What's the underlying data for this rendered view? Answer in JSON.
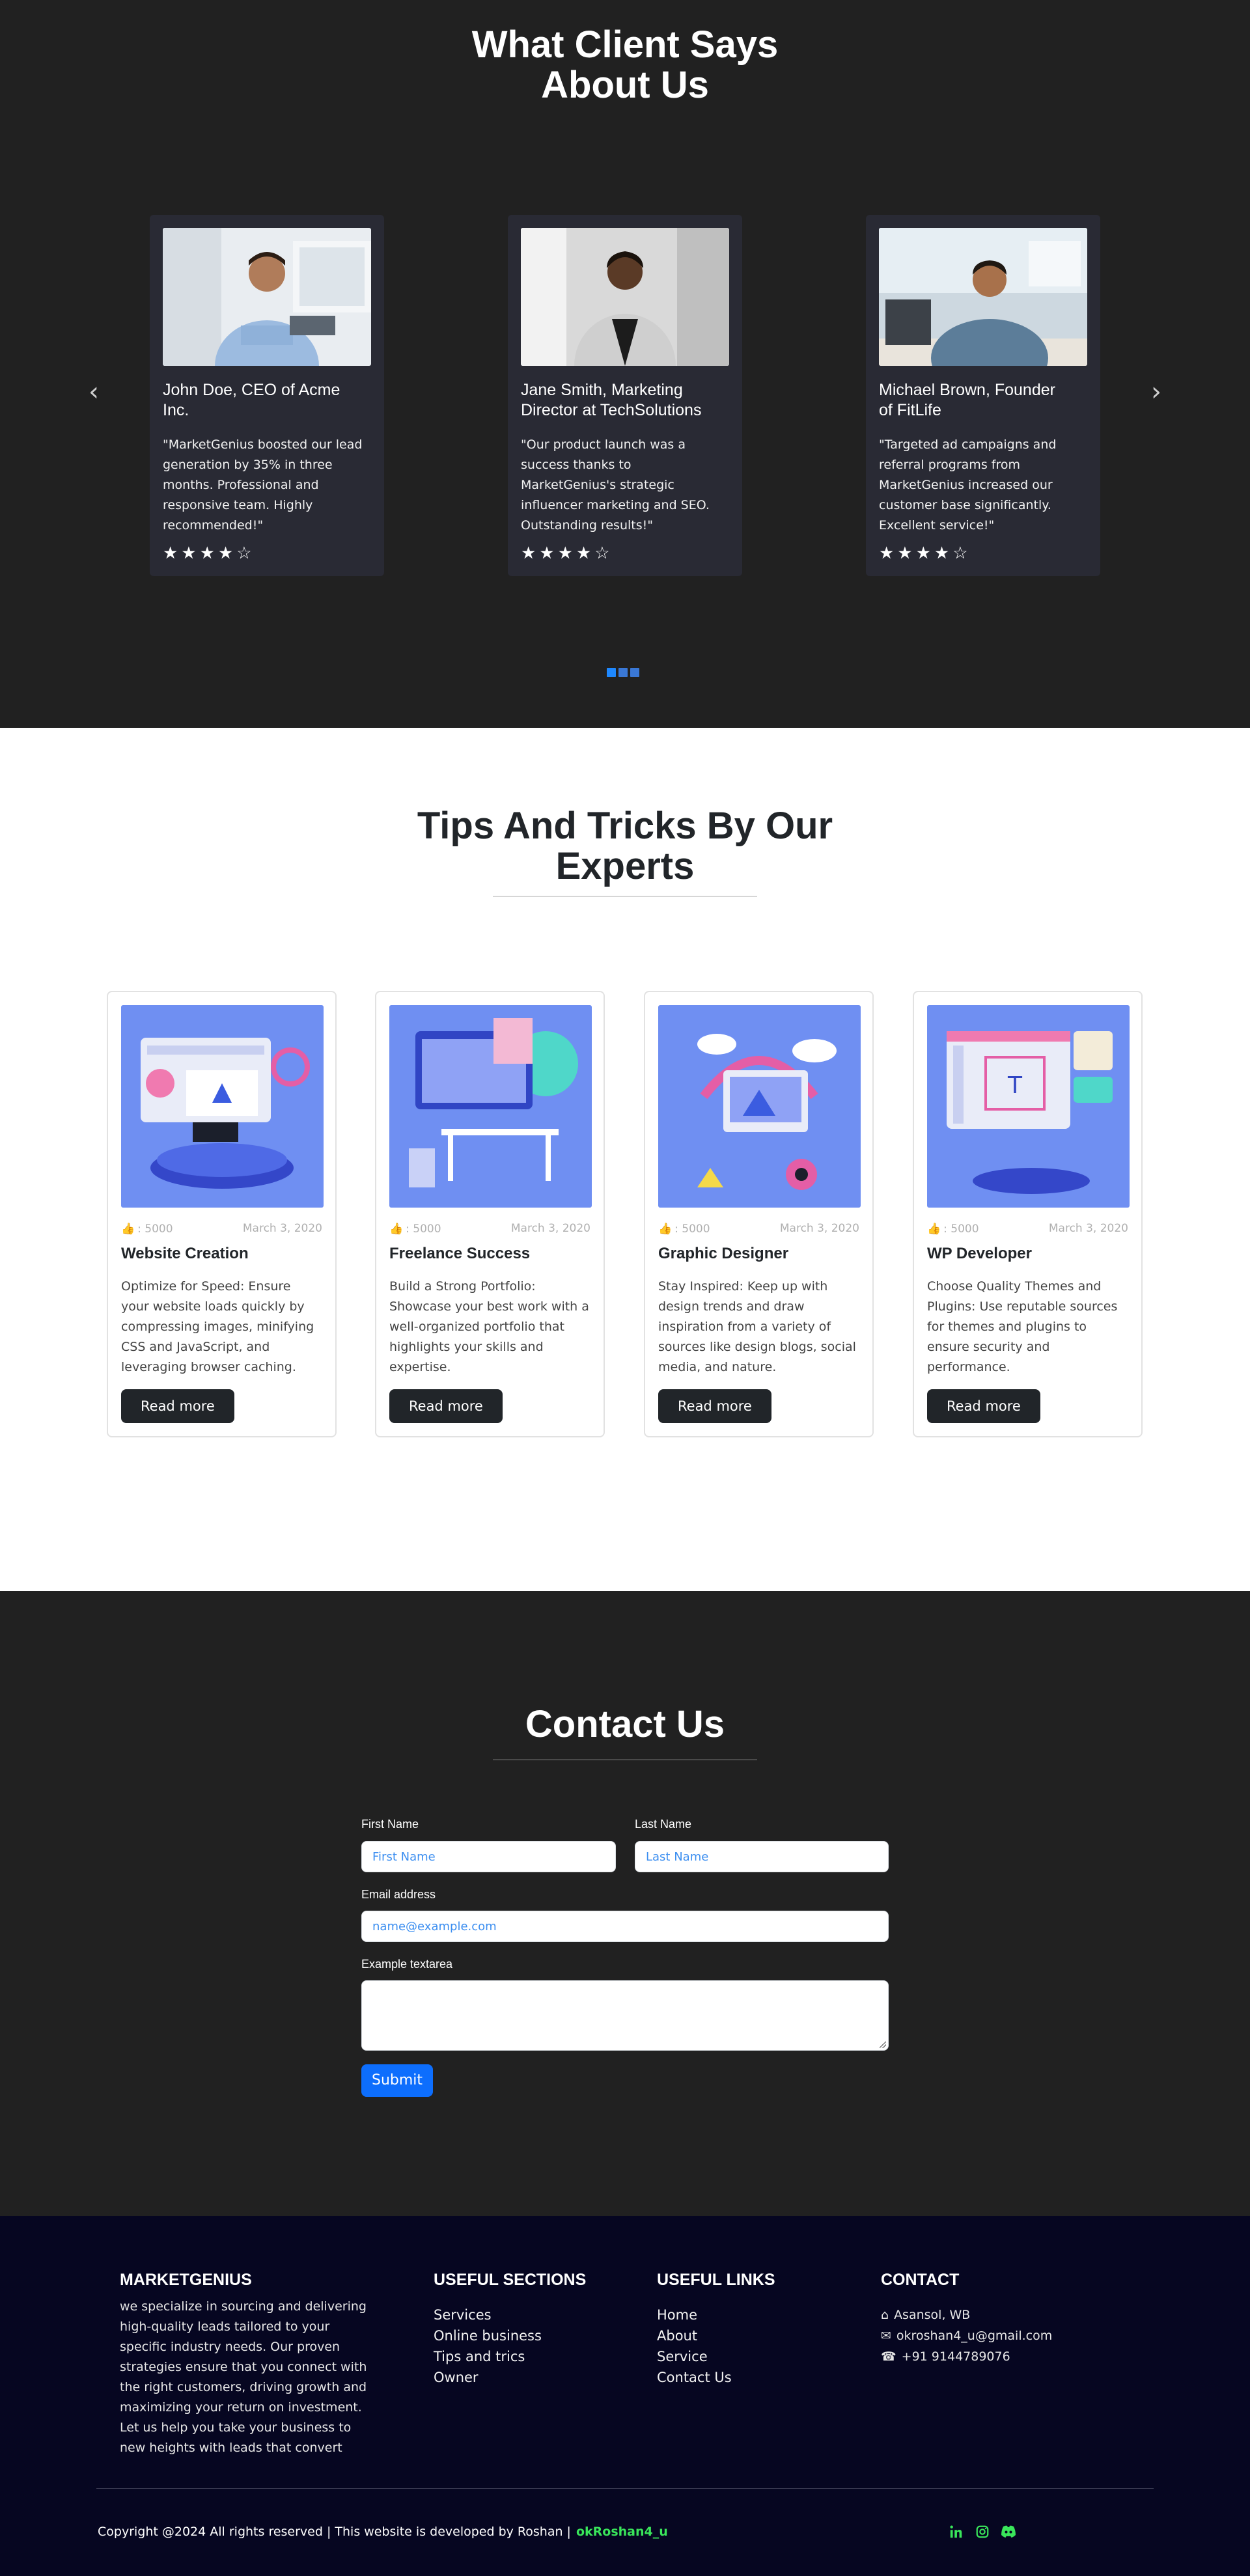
{
  "testimonials": {
    "title_line1": "What Client Says",
    "title_line2": "About Us",
    "prev_icon": "chevron-left-icon",
    "next_icon": "chevron-right-icon",
    "cards": [
      {
        "name_line1": "John Doe, CEO of Acme",
        "name_line2": "Inc.",
        "quote": "\"MarketGenius boosted our lead generation by 35% in three months. Professional and responsive team. Highly recommended!\"",
        "rating": 4,
        "stars": "★★★★☆"
      },
      {
        "name_line1": "Jane Smith, Marketing",
        "name_line2": "Director at TechSolutions",
        "quote": "\"Our product launch was a success thanks to MarketGenius's strategic influencer marketing and SEO. Outstanding results!\"",
        "rating": 4,
        "stars": "★★★★☆"
      },
      {
        "name_line1": "Michael Brown, Founder",
        "name_line2": "of FitLife",
        "quote": "\"Targeted ad campaigns and referral programs from MarketGenius increased our customer base significantly. Excellent service!\"",
        "rating": 4,
        "stars": "★★★★☆"
      }
    ],
    "indicator_count": 3,
    "active_indicator": 1
  },
  "tips": {
    "title_line1": "Tips And Tricks By Our",
    "title_line2": "Experts",
    "cards": [
      {
        "likes": ": 5000",
        "date": "March 3, 2020",
        "title": "Website Creation",
        "text": "Optimize for Speed: Ensure your website loads quickly by compressing images, minifying CSS and JavaScript, and leveraging browser caching.",
        "button": "Read more"
      },
      {
        "likes": ": 5000",
        "date": "March 3, 2020",
        "title": "Freelance Success",
        "text": "Build a Strong Portfolio: Showcase your best work with a well-organized portfolio that highlights your skills and expertise.",
        "button": "Read more"
      },
      {
        "likes": ": 5000",
        "date": "March 3, 2020",
        "title": "Graphic Designer",
        "text": "Stay Inspired: Keep up with design trends and draw inspiration from a variety of sources like design blogs, social media, and nature.",
        "button": "Read more"
      },
      {
        "likes": ": 5000",
        "date": "March 3, 2020",
        "title": "WP Developer",
        "text": "Choose Quality Themes and Plugins: Use reputable sources for themes and plugins to ensure security and performance.",
        "button": "Read more"
      }
    ]
  },
  "contact": {
    "title": "Contact Us",
    "first_name_label": "First Name",
    "first_name_placeholder": "First Name",
    "last_name_label": "Last Name",
    "last_name_placeholder": "Last Name",
    "email_label": "Email address",
    "email_placeholder": "name@example.com",
    "textarea_label": "Example textarea",
    "submit": "Submit"
  },
  "footer": {
    "brand": "MARKETGENIUS",
    "about": "we specialize in sourcing and delivering high-quality leads tailored to your specific industry needs. Our proven strategies ensure that you connect with the right customers, driving growth and maximizing your return on investment. Let us help you take your business to new heights with leads that convert",
    "sections_heading": "USEFUL SECTIONS",
    "sections": [
      "Services",
      "Online business",
      "Tips and trics",
      "Owner"
    ],
    "links_heading": "USEFUL LINKS",
    "links": [
      "Home",
      "About",
      "Service",
      "Contact Us"
    ],
    "contact_heading": "CONTACT",
    "address": "Asansol, WB",
    "email": "okroshan4_u@gmail.com",
    "phone": "+91 9144789076",
    "copyright": "Copyright @2024 All rights reserved | This website is developed by Roshan |",
    "handle": "okRoshan4_u",
    "accent_color": "#39e55a",
    "social_icons": [
      "linkedin-icon",
      "instagram-icon",
      "discord-icon"
    ]
  }
}
